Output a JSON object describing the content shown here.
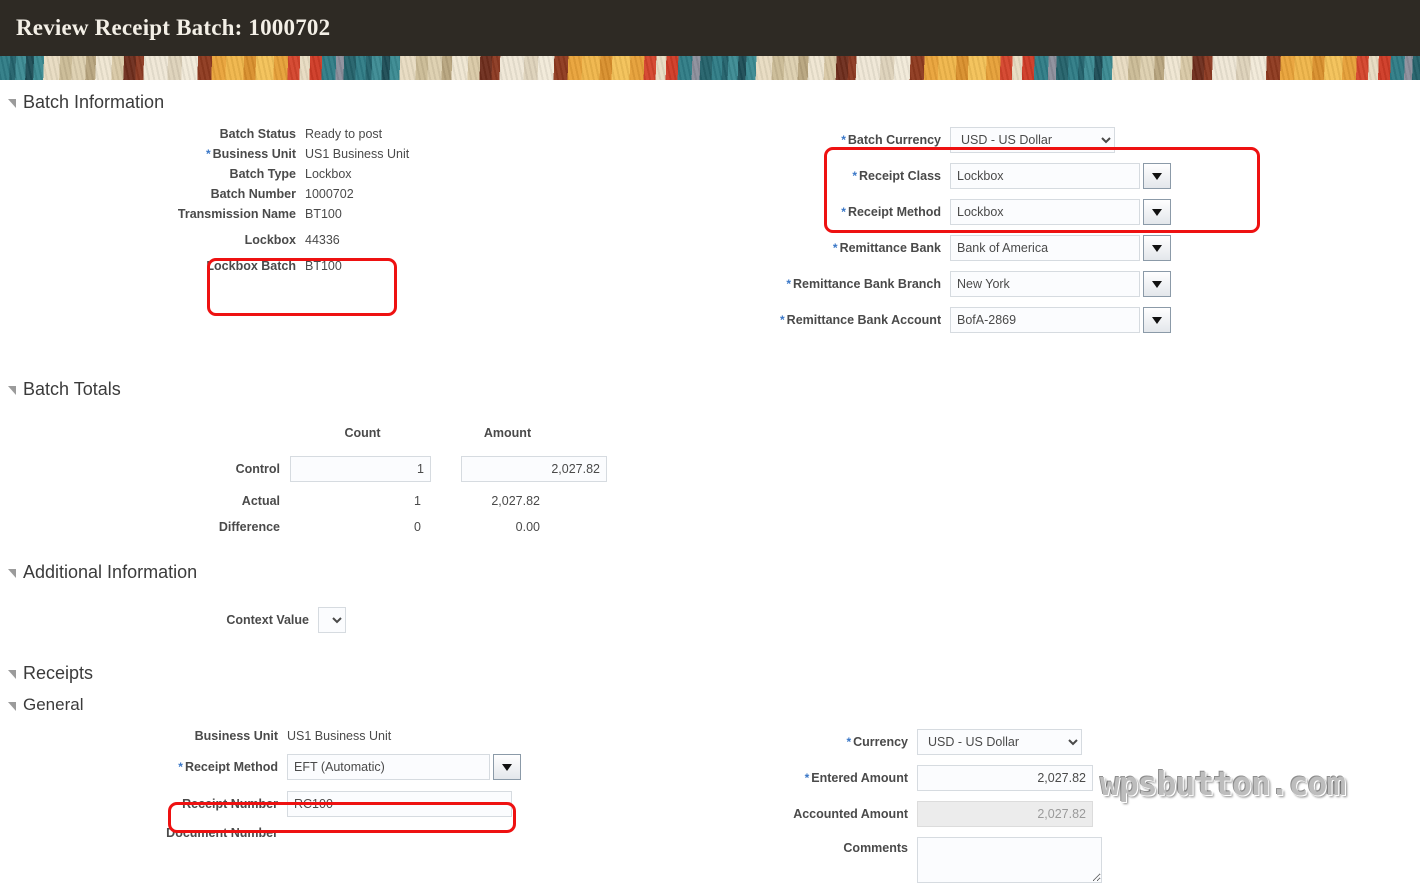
{
  "header": {
    "title": "Review Receipt Batch: 1000702",
    "bg_color": "#2e2a24",
    "title_color": "#f3efe6"
  },
  "annotation": {
    "color": "#ee1111"
  },
  "watermark": {
    "text": "wpsbutton.com"
  },
  "batch_information": {
    "section_title": "Batch Information",
    "left_fields": [
      {
        "label": "Batch Status",
        "required": false,
        "value": "Ready to post"
      },
      {
        "label": "Business Unit",
        "required": true,
        "value": "US1 Business Unit"
      },
      {
        "label": "Batch Type",
        "required": false,
        "value": "Lockbox"
      },
      {
        "label": "Batch Number",
        "required": false,
        "value": "1000702"
      },
      {
        "label": "Transmission Name",
        "required": false,
        "value": "BT100"
      },
      {
        "label": "Lockbox",
        "required": false,
        "value": "44336"
      },
      {
        "label": "Lockbox Batch",
        "required": false,
        "value": "BT100"
      }
    ],
    "right_fields": [
      {
        "label": "Batch Currency",
        "required": true,
        "value": "USD - US Dollar",
        "control": "select"
      },
      {
        "label": "Receipt Class",
        "required": true,
        "value": "Lockbox",
        "control": "lov"
      },
      {
        "label": "Receipt Method",
        "required": true,
        "value": "Lockbox",
        "control": "lov"
      },
      {
        "label": "Remittance Bank",
        "required": true,
        "value": "Bank of America",
        "control": "lov"
      },
      {
        "label": "Remittance Bank Branch",
        "required": true,
        "value": "New York",
        "control": "lov"
      },
      {
        "label": "Remittance Bank Account",
        "required": true,
        "value": "BofA-2869",
        "control": "lov"
      }
    ]
  },
  "batch_totals": {
    "section_title": "Batch Totals",
    "column_headers": [
      "Count",
      "Amount"
    ],
    "rows": [
      {
        "label": "Control",
        "count": "1",
        "amount": "2,027.82",
        "editable": true
      },
      {
        "label": "Actual",
        "count": "1",
        "amount": "2,027.82",
        "editable": false
      },
      {
        "label": "Difference",
        "count": "0",
        "amount": "0.00",
        "editable": false
      }
    ]
  },
  "additional_information": {
    "section_title": "Additional Information",
    "context_value": {
      "label": "Context Value",
      "value": ""
    }
  },
  "receipts": {
    "section_title": "Receipts",
    "general": {
      "section_title": "General",
      "left_fields": [
        {
          "label": "Business Unit",
          "required": false,
          "value": "US1 Business Unit",
          "control": "text"
        },
        {
          "label": "Receipt Method",
          "required": true,
          "value": "EFT (Automatic)",
          "control": "lov"
        },
        {
          "label": "Receipt Number",
          "required": false,
          "value": "RC100",
          "control": "input"
        },
        {
          "label": "Document Number",
          "required": false,
          "value": "",
          "control": "label-only"
        }
      ],
      "right_fields": [
        {
          "label": "Currency",
          "required": true,
          "value": "USD - US Dollar",
          "control": "select"
        },
        {
          "label": "Entered Amount",
          "required": true,
          "value": "2,027.82",
          "control": "input-num"
        },
        {
          "label": "Accounted Amount",
          "required": false,
          "value": "2,027.82",
          "control": "input-ro"
        },
        {
          "label": "Comments",
          "required": false,
          "value": "",
          "control": "textarea"
        }
      ]
    }
  }
}
